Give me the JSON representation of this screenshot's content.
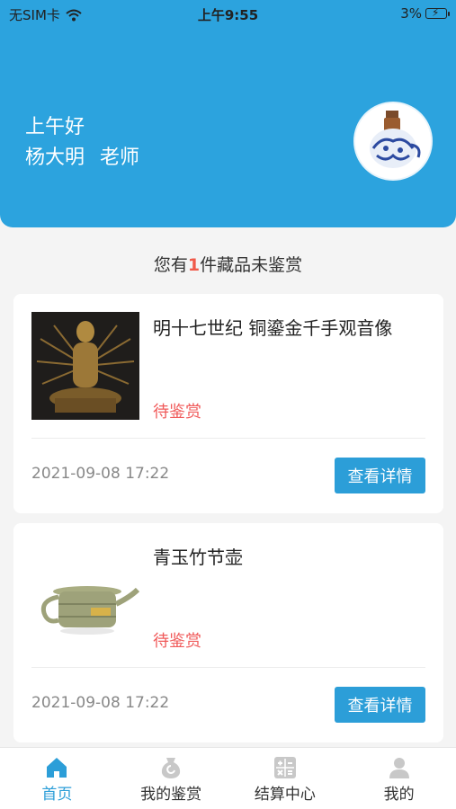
{
  "status_bar": {
    "carrier": "无SIM卡",
    "time": "上午9:55",
    "battery": "3%"
  },
  "header": {
    "greeting": "上午好",
    "user_name": "杨大明",
    "user_role": "老师"
  },
  "pending": {
    "prefix": "您有",
    "count": "1",
    "suffix": "件藏品未鉴赏"
  },
  "items": [
    {
      "title": "明十七世纪 铜鎏金千手观音像",
      "status": "待鉴赏",
      "date": "2021-09-08 17:22",
      "button": "查看详情"
    },
    {
      "title": "青玉竹节壶",
      "status": "待鉴赏",
      "date": "2021-09-08 17:22",
      "button": "查看详情"
    }
  ],
  "tabbar": {
    "tabs": [
      {
        "label": "首页",
        "icon": "home-icon",
        "active": true
      },
      {
        "label": "我的鉴赏",
        "icon": "appraisal-icon",
        "active": false
      },
      {
        "label": "结算中心",
        "icon": "calculator-icon",
        "active": false
      },
      {
        "label": "我的",
        "icon": "user-icon",
        "active": false
      }
    ]
  },
  "colors": {
    "primary": "#2ca3de",
    "status_pending": "#f05a5a",
    "count_highlight": "#f05a4a",
    "tab_active": "#2c9ed8",
    "tab_inactive": "#c8c8c8"
  }
}
